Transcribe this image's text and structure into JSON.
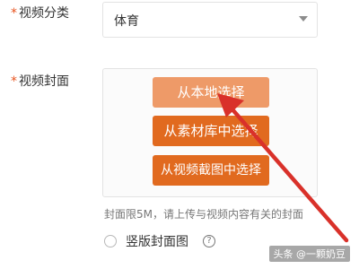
{
  "form": {
    "category": {
      "required_mark": "*",
      "label": "视频分类",
      "selected": "体育"
    },
    "cover": {
      "required_mark": "*",
      "label": "视频封面",
      "buttons": {
        "local": "从本地选择",
        "library": "从素材库中选择",
        "frame": "从视频截图中选择"
      },
      "hint": "封面限5M，请上传与视频内容有关的封面",
      "vertical_option": "竖版封面图",
      "help_symbol": "?"
    }
  },
  "watermark": "头条 @一颗奶豆",
  "colors": {
    "accent": "#e16a1f",
    "accent_light": "#ee9a68",
    "annotation_arrow": "#d9312a"
  }
}
